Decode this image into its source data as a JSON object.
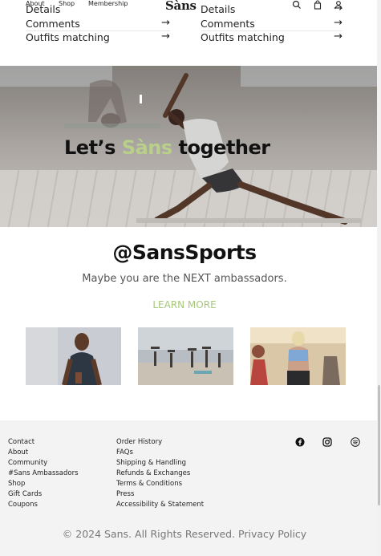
{
  "nav": {
    "items": [
      "About",
      "Shop",
      "Membership"
    ],
    "logo": "Sàns",
    "icons": [
      "search-icon",
      "bag-icon",
      "user-icon"
    ]
  },
  "product_links": {
    "left": [
      {
        "label": "Details",
        "arrow": "→"
      },
      {
        "label": "Comments",
        "arrow": "→"
      },
      {
        "label": "Outfits matching",
        "arrow": "→"
      }
    ],
    "right": [
      {
        "label": "Details",
        "arrow": "→"
      },
      {
        "label": "Comments",
        "arrow": "→"
      },
      {
        "label": "Outfits matching",
        "arrow": "→"
      }
    ]
  },
  "hero": {
    "title_before": "Let’s ",
    "title_accent": "Sàns",
    "title_after": " together"
  },
  "ambassadors": {
    "title": "@SansSports",
    "subtitle": "Maybe you are the NEXT ambassadors.",
    "learn_more": "LEARN MORE",
    "images": [
      "meditation-photo",
      "beach-yoga-photo",
      "gym-photo"
    ]
  },
  "footer": {
    "col1": [
      "Contact",
      "About",
      "Community",
      "#Sans Ambassadors",
      "Shop",
      "Gift Cards",
      "Coupons"
    ],
    "col2": [
      "Order History",
      "FAQs",
      "Shipping & Handling",
      "Refunds & Exchanges",
      "Terms & Conditions",
      "Press",
      "Accessibility & Statement"
    ],
    "social_icons": [
      "facebook-icon",
      "instagram-icon",
      "spotify-icon"
    ],
    "copyright": "© 2024 Sans. All Rights Reserved. Privacy Policy"
  },
  "colors": {
    "accent": "#b8d08a",
    "learn_more": "#a7c77a",
    "footer_bg": "#f3f3f3"
  }
}
